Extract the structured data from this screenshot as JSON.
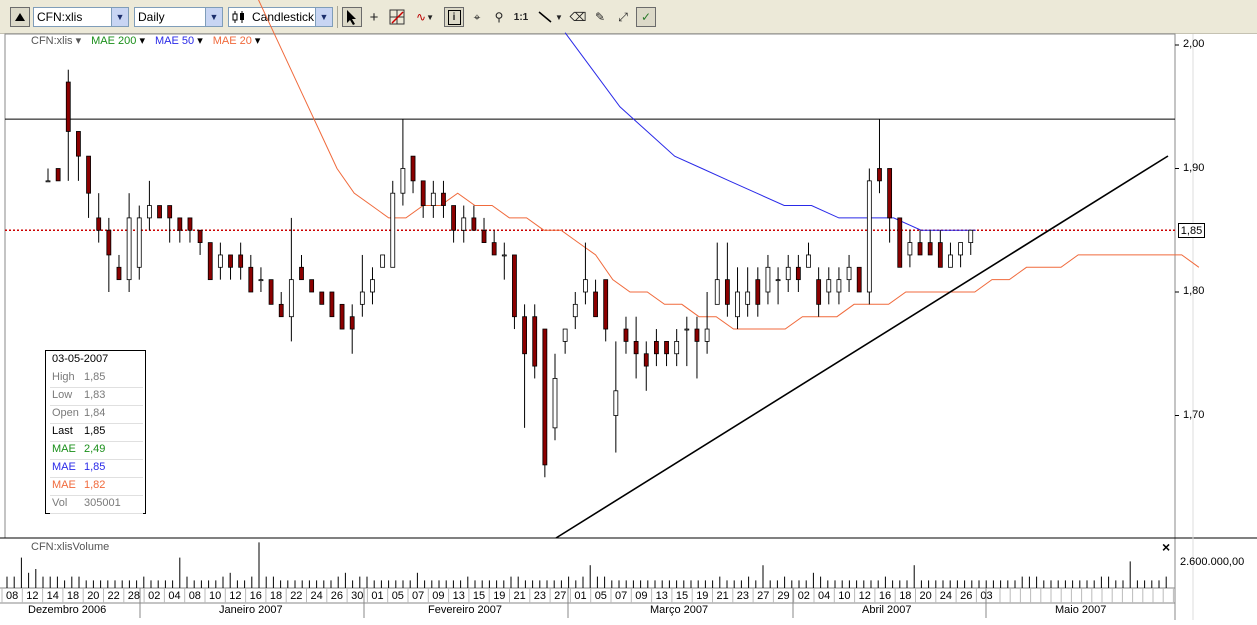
{
  "toolbar": {
    "symbol": "CFN:xlis",
    "period": "Daily",
    "chart_type": "Candlestick",
    "zoom_1to1": "1:1"
  },
  "legend": {
    "symbol": "CFN:xlis",
    "mae200": "MAE 200",
    "mae50": "MAE 50",
    "mae20": "MAE 20",
    "colors": {
      "mae200": "#1a8f1a",
      "mae50": "#2a2ae8",
      "mae20": "#f06a3c"
    }
  },
  "info": {
    "date": "03-05-2007",
    "rows": [
      {
        "k": "High",
        "v": "1,85",
        "color": "#7a7a7a"
      },
      {
        "k": "Low",
        "v": "1,83",
        "color": "#7a7a7a"
      },
      {
        "k": "Open",
        "v": "1,84",
        "color": "#7a7a7a"
      },
      {
        "k": "Last",
        "v": "1,85",
        "color": "#000000"
      },
      {
        "k": "MAE",
        "v": "2,49",
        "color": "#1a8f1a"
      },
      {
        "k": "MAE",
        "v": "1,85",
        "color": "#2a2ae8"
      },
      {
        "k": "MAE",
        "v": "1,82",
        "color": "#f06a3c"
      },
      {
        "k": "Vol",
        "v": "305001",
        "color": "#7a7a7a"
      }
    ]
  },
  "price_axis": {
    "labels": [
      "2,00",
      "1,90",
      "1,80",
      "1,70"
    ],
    "current": "1,85"
  },
  "volume_panel": {
    "title": "CFN:xlisVolume",
    "axis_label": "2.600.000,00",
    "close": "×"
  },
  "months": [
    "Dezembro 2006",
    "Janeiro 2007",
    "Fevereiro 2007",
    "Março 2007",
    "Abril 2007",
    "Maio 2007"
  ],
  "chart_data": {
    "type": "candlestick",
    "title": "CFN:xlis",
    "ylim": [
      1.6,
      2.01
    ],
    "grid": false,
    "reference_lines": [
      {
        "kind": "horizontal",
        "value": 1.94,
        "color": "#000000"
      },
      {
        "kind": "horizontal",
        "value": 1.85,
        "color": "#cc0000",
        "style": "dotted"
      }
    ],
    "trendline": {
      "from": {
        "date": "2006-12-28",
        "value": 1.62
      },
      "to": {
        "date": "2007-05-13",
        "value": 1.91
      }
    },
    "date_ticks": [
      "08",
      "12",
      "14",
      "18",
      "20",
      "22",
      "28",
      "02",
      "04",
      "08",
      "10",
      "12",
      "16",
      "18",
      "22",
      "24",
      "26",
      "30",
      "01",
      "05",
      "07",
      "09",
      "13",
      "15",
      "19",
      "21",
      "23",
      "27",
      "01",
      "05",
      "07",
      "09",
      "13",
      "15",
      "19",
      "21",
      "23",
      "27",
      "29",
      "02",
      "04",
      "10",
      "12",
      "16",
      "18",
      "20",
      "24",
      "26",
      "03"
    ],
    "candles": [
      {
        "o": 1.89,
        "h": 1.9,
        "l": 1.89,
        "c": 1.89
      },
      {
        "o": 1.9,
        "h": 1.9,
        "l": 1.89,
        "c": 1.89
      },
      {
        "o": 1.97,
        "h": 1.98,
        "l": 1.89,
        "c": 1.93
      },
      {
        "o": 1.93,
        "h": 1.93,
        "l": 1.89,
        "c": 1.91
      },
      {
        "o": 1.91,
        "h": 1.91,
        "l": 1.86,
        "c": 1.88
      },
      {
        "o": 1.86,
        "h": 1.88,
        "l": 1.84,
        "c": 1.85
      },
      {
        "o": 1.85,
        "h": 1.86,
        "l": 1.8,
        "c": 1.83
      },
      {
        "o": 1.82,
        "h": 1.83,
        "l": 1.81,
        "c": 1.81
      },
      {
        "o": 1.81,
        "h": 1.88,
        "l": 1.8,
        "c": 1.86
      },
      {
        "o": 1.82,
        "h": 1.87,
        "l": 1.81,
        "c": 1.86
      },
      {
        "o": 1.86,
        "h": 1.89,
        "l": 1.85,
        "c": 1.87
      },
      {
        "o": 1.87,
        "h": 1.87,
        "l": 1.86,
        "c": 1.86
      },
      {
        "o": 1.87,
        "h": 1.87,
        "l": 1.84,
        "c": 1.86
      },
      {
        "o": 1.86,
        "h": 1.86,
        "l": 1.84,
        "c": 1.85
      },
      {
        "o": 1.86,
        "h": 1.86,
        "l": 1.84,
        "c": 1.85
      },
      {
        "o": 1.85,
        "h": 1.85,
        "l": 1.83,
        "c": 1.84
      },
      {
        "o": 1.84,
        "h": 1.84,
        "l": 1.81,
        "c": 1.81
      },
      {
        "o": 1.82,
        "h": 1.84,
        "l": 1.81,
        "c": 1.83
      },
      {
        "o": 1.83,
        "h": 1.83,
        "l": 1.81,
        "c": 1.82
      },
      {
        "o": 1.83,
        "h": 1.84,
        "l": 1.81,
        "c": 1.82
      },
      {
        "o": 1.82,
        "h": 1.83,
        "l": 1.8,
        "c": 1.8
      },
      {
        "o": 1.81,
        "h": 1.82,
        "l": 1.8,
        "c": 1.81
      },
      {
        "o": 1.81,
        "h": 1.81,
        "l": 1.79,
        "c": 1.79
      },
      {
        "o": 1.79,
        "h": 1.8,
        "l": 1.78,
        "c": 1.78
      },
      {
        "o": 1.78,
        "h": 1.86,
        "l": 1.76,
        "c": 1.81
      },
      {
        "o": 1.82,
        "h": 1.83,
        "l": 1.81,
        "c": 1.81
      },
      {
        "o": 1.81,
        "h": 1.81,
        "l": 1.8,
        "c": 1.8
      },
      {
        "o": 1.8,
        "h": 1.8,
        "l": 1.79,
        "c": 1.79
      },
      {
        "o": 1.8,
        "h": 1.8,
        "l": 1.78,
        "c": 1.78
      },
      {
        "o": 1.79,
        "h": 1.79,
        "l": 1.77,
        "c": 1.77
      },
      {
        "o": 1.78,
        "h": 1.79,
        "l": 1.75,
        "c": 1.77
      },
      {
        "o": 1.79,
        "h": 1.83,
        "l": 1.78,
        "c": 1.8
      },
      {
        "o": 1.8,
        "h": 1.82,
        "l": 1.79,
        "c": 1.81
      },
      {
        "o": 1.82,
        "h": 1.83,
        "l": 1.82,
        "c": 1.83
      },
      {
        "o": 1.82,
        "h": 1.89,
        "l": 1.82,
        "c": 1.88
      },
      {
        "o": 1.88,
        "h": 1.94,
        "l": 1.87,
        "c": 1.9
      },
      {
        "o": 1.91,
        "h": 1.91,
        "l": 1.88,
        "c": 1.89
      },
      {
        "o": 1.89,
        "h": 1.89,
        "l": 1.86,
        "c": 1.87
      },
      {
        "o": 1.87,
        "h": 1.89,
        "l": 1.86,
        "c": 1.88
      },
      {
        "o": 1.88,
        "h": 1.89,
        "l": 1.86,
        "c": 1.87
      },
      {
        "o": 1.87,
        "h": 1.87,
        "l": 1.84,
        "c": 1.85
      },
      {
        "o": 1.85,
        "h": 1.87,
        "l": 1.84,
        "c": 1.86
      },
      {
        "o": 1.86,
        "h": 1.87,
        "l": 1.85,
        "c": 1.85
      },
      {
        "o": 1.85,
        "h": 1.86,
        "l": 1.84,
        "c": 1.84
      },
      {
        "o": 1.84,
        "h": 1.85,
        "l": 1.83,
        "c": 1.83
      },
      {
        "o": 1.83,
        "h": 1.84,
        "l": 1.81,
        "c": 1.83
      },
      {
        "o": 1.83,
        "h": 1.83,
        "l": 1.77,
        "c": 1.78
      },
      {
        "o": 1.78,
        "h": 1.79,
        "l": 1.69,
        "c": 1.75
      },
      {
        "o": 1.78,
        "h": 1.79,
        "l": 1.73,
        "c": 1.74
      },
      {
        "o": 1.77,
        "h": 1.77,
        "l": 1.65,
        "c": 1.66
      },
      {
        "o": 1.69,
        "h": 1.75,
        "l": 1.68,
        "c": 1.73
      },
      {
        "o": 1.76,
        "h": 1.77,
        "l": 1.75,
        "c": 1.77
      },
      {
        "o": 1.78,
        "h": 1.8,
        "l": 1.77,
        "c": 1.79
      },
      {
        "o": 1.8,
        "h": 1.84,
        "l": 1.79,
        "c": 1.81
      },
      {
        "o": 1.8,
        "h": 1.81,
        "l": 1.78,
        "c": 1.78
      },
      {
        "o": 1.81,
        "h": 1.81,
        "l": 1.76,
        "c": 1.77
      },
      {
        "o": 1.7,
        "h": 1.76,
        "l": 1.67,
        "c": 1.72
      },
      {
        "o": 1.77,
        "h": 1.78,
        "l": 1.75,
        "c": 1.76
      },
      {
        "o": 1.76,
        "h": 1.78,
        "l": 1.73,
        "c": 1.75
      },
      {
        "o": 1.75,
        "h": 1.76,
        "l": 1.72,
        "c": 1.74
      },
      {
        "o": 1.76,
        "h": 1.77,
        "l": 1.74,
        "c": 1.75
      },
      {
        "o": 1.76,
        "h": 1.76,
        "l": 1.74,
        "c": 1.75
      },
      {
        "o": 1.75,
        "h": 1.77,
        "l": 1.74,
        "c": 1.76
      },
      {
        "o": 1.77,
        "h": 1.78,
        "l": 1.74,
        "c": 1.77
      },
      {
        "o": 1.77,
        "h": 1.78,
        "l": 1.73,
        "c": 1.76
      },
      {
        "o": 1.76,
        "h": 1.8,
        "l": 1.75,
        "c": 1.77
      },
      {
        "o": 1.79,
        "h": 1.84,
        "l": 1.79,
        "c": 1.81
      },
      {
        "o": 1.81,
        "h": 1.84,
        "l": 1.78,
        "c": 1.79
      },
      {
        "o": 1.78,
        "h": 1.82,
        "l": 1.77,
        "c": 1.8
      },
      {
        "o": 1.79,
        "h": 1.82,
        "l": 1.78,
        "c": 1.8
      },
      {
        "o": 1.81,
        "h": 1.82,
        "l": 1.78,
        "c": 1.79
      },
      {
        "o": 1.8,
        "h": 1.83,
        "l": 1.79,
        "c": 1.82
      },
      {
        "o": 1.81,
        "h": 1.82,
        "l": 1.79,
        "c": 1.81
      },
      {
        "o": 1.81,
        "h": 1.83,
        "l": 1.8,
        "c": 1.82
      },
      {
        "o": 1.82,
        "h": 1.83,
        "l": 1.8,
        "c": 1.81
      },
      {
        "o": 1.82,
        "h": 1.84,
        "l": 1.82,
        "c": 1.83
      },
      {
        "o": 1.81,
        "h": 1.82,
        "l": 1.78,
        "c": 1.79
      },
      {
        "o": 1.8,
        "h": 1.82,
        "l": 1.79,
        "c": 1.81
      },
      {
        "o": 1.8,
        "h": 1.82,
        "l": 1.79,
        "c": 1.81
      },
      {
        "o": 1.81,
        "h": 1.83,
        "l": 1.8,
        "c": 1.82
      },
      {
        "o": 1.82,
        "h": 1.82,
        "l": 1.8,
        "c": 1.8
      },
      {
        "o": 1.8,
        "h": 1.9,
        "l": 1.79,
        "c": 1.89
      },
      {
        "o": 1.9,
        "h": 1.94,
        "l": 1.88,
        "c": 1.89
      },
      {
        "o": 1.9,
        "h": 1.9,
        "l": 1.84,
        "c": 1.86
      },
      {
        "o": 1.86,
        "h": 1.86,
        "l": 1.82,
        "c": 1.82
      },
      {
        "o": 1.83,
        "h": 1.85,
        "l": 1.82,
        "c": 1.84
      },
      {
        "o": 1.84,
        "h": 1.85,
        "l": 1.83,
        "c": 1.83
      },
      {
        "o": 1.84,
        "h": 1.85,
        "l": 1.83,
        "c": 1.83
      },
      {
        "o": 1.84,
        "h": 1.85,
        "l": 1.82,
        "c": 1.82
      },
      {
        "o": 1.82,
        "h": 1.84,
        "l": 1.82,
        "c": 1.83
      },
      {
        "o": 1.83,
        "h": 1.84,
        "l": 1.82,
        "c": 1.84
      },
      {
        "o": 1.84,
        "h": 1.85,
        "l": 1.83,
        "c": 1.85
      }
    ],
    "series": [
      {
        "name": "MAE 20",
        "values": [
          2.05,
          2.02,
          1.99,
          1.96,
          1.93,
          1.9,
          1.88,
          1.87,
          1.86,
          1.86,
          1.87,
          1.87,
          1.88,
          1.87,
          1.87,
          1.86,
          1.86,
          1.85,
          1.85,
          1.84,
          1.83,
          1.81,
          1.8,
          1.8,
          1.79,
          1.79,
          1.78,
          1.78,
          1.77,
          1.77,
          1.77,
          1.77,
          1.78,
          1.78,
          1.78,
          1.79,
          1.79,
          1.79,
          1.8,
          1.8,
          1.8,
          1.8,
          1.8,
          1.81,
          1.81,
          1.82,
          1.82,
          1.82,
          1.83,
          1.83,
          1.83,
          1.83,
          1.83,
          1.83,
          1.83,
          1.82
        ]
      },
      {
        "name": "MAE 50",
        "values": [
          2.01,
          1.98,
          1.95,
          1.93,
          1.91,
          1.9,
          1.89,
          1.88,
          1.87,
          1.87,
          1.86,
          1.86,
          1.86,
          1.85,
          1.85,
          1.85
        ]
      }
    ],
    "volume": [
      3,
      3,
      8,
      4,
      5,
      3,
      3,
      3,
      2,
      3,
      3,
      2,
      2,
      2,
      2,
      2,
      2,
      2,
      2,
      3,
      2,
      2,
      2,
      2,
      8,
      3,
      2,
      2,
      2,
      2,
      3,
      4,
      2,
      2,
      3,
      12,
      3,
      3,
      2,
      2,
      2,
      2,
      2,
      2,
      2,
      2,
      3,
      4,
      2,
      3,
      3,
      2,
      2,
      2,
      2,
      2,
      2,
      4,
      2,
      2,
      2,
      2,
      2,
      2,
      3,
      2,
      2,
      2,
      2,
      2,
      3,
      3,
      2,
      2,
      2,
      2,
      2,
      2,
      3,
      2,
      3,
      6,
      3,
      3,
      2,
      2,
      2,
      2,
      2,
      2,
      2,
      2,
      2,
      2,
      2,
      2,
      2,
      2,
      2,
      3,
      2,
      2,
      2,
      3,
      2,
      6,
      2,
      2,
      3,
      2,
      2,
      2,
      4,
      3,
      2,
      2,
      2,
      2,
      2,
      2,
      2,
      2,
      3,
      2,
      2,
      2,
      6,
      2,
      2,
      2,
      2,
      2,
      2,
      2,
      2,
      2,
      2,
      2,
      2,
      2,
      2,
      3,
      3,
      3,
      2,
      2,
      2,
      2,
      2,
      2,
      2,
      2,
      3,
      3,
      2,
      2,
      7,
      2,
      2,
      2,
      2,
      3
    ]
  }
}
